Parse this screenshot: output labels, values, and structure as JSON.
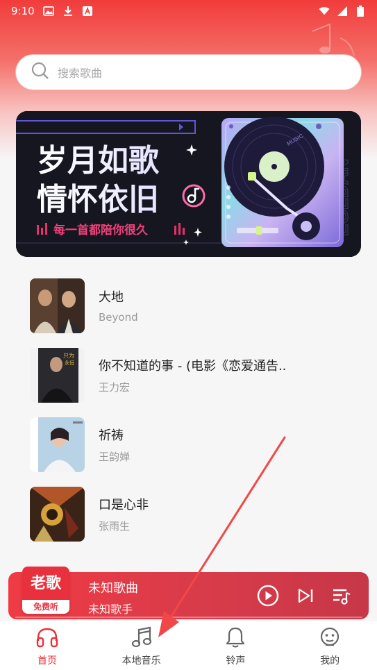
{
  "status": {
    "time": "9:10"
  },
  "search": {
    "placeholder": "搜索歌曲"
  },
  "banner": {
    "line1": "岁月如歌",
    "line2": "情怀依旧",
    "tagline": "每一首都陪你很久",
    "side_text": "EGEDAN",
    "record_label": "MUSIC"
  },
  "songs": [
    {
      "title": "大地",
      "artist": "Beyond"
    },
    {
      "title": "你不知道的事 - (电影《恋爱通告..",
      "artist": "王力宏"
    },
    {
      "title": "祈祷",
      "artist": "王韵婵"
    },
    {
      "title": "口是心非",
      "artist": "张雨生"
    }
  ],
  "player": {
    "logo_main": "老歌",
    "logo_sub": "免费听",
    "title": "未知歌曲",
    "artist": "未知歌手",
    "progress": 0
  },
  "tabs": [
    {
      "label": "首页",
      "icon": "headphones-icon",
      "active": true
    },
    {
      "label": "本地音乐",
      "icon": "music-note-icon",
      "active": false
    },
    {
      "label": "铃声",
      "icon": "bell-icon",
      "active": false
    },
    {
      "label": "我的",
      "icon": "smiley-face-icon",
      "active": false
    }
  ],
  "colors": {
    "accent": "#e8313d",
    "header_top": "#f13c3b",
    "annotation_arrow": "#f04848"
  }
}
